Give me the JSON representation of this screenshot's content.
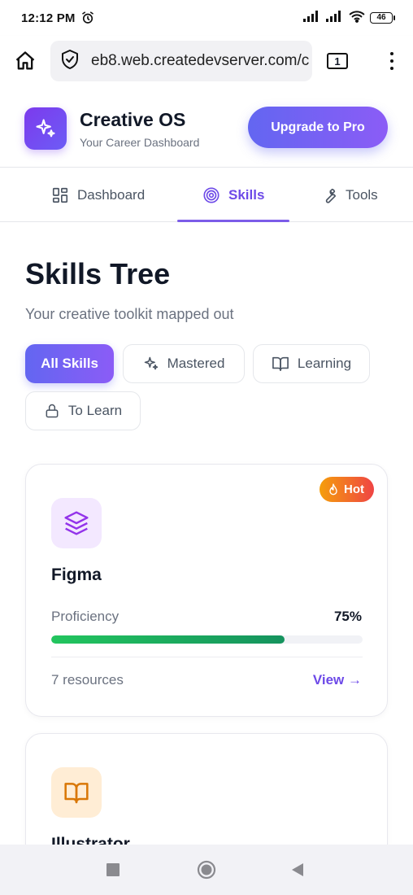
{
  "status_bar": {
    "time": "12:12 PM",
    "battery": "46"
  },
  "browser": {
    "url": "eb8.web.createdevserver.com/c",
    "tab_count": "1"
  },
  "header": {
    "app_name": "Creative OS",
    "tagline": "Your Career Dashboard",
    "upgrade_label": "Upgrade to Pro"
  },
  "tabs": [
    {
      "label": "Dashboard",
      "icon": "grid-icon",
      "active": false
    },
    {
      "label": "Skills",
      "icon": "target-icon",
      "active": true
    },
    {
      "label": "Tools",
      "icon": "wrench-icon",
      "active": false
    }
  ],
  "page": {
    "title": "Skills Tree",
    "subtitle": "Your creative toolkit mapped out"
  },
  "filters": [
    {
      "label": "All Skills",
      "icon": "",
      "active": true
    },
    {
      "label": "Mastered",
      "icon": "sparkles-icon",
      "active": false
    },
    {
      "label": "Learning",
      "icon": "book-icon",
      "active": false
    },
    {
      "label": "To Learn",
      "icon": "lock-icon",
      "active": false
    }
  ],
  "skills": [
    {
      "name": "Figma",
      "icon": "layers-icon",
      "badge": "Hot",
      "proficiency_label": "Proficiency",
      "proficiency_value": "75%",
      "proficiency": 0.75,
      "resources": "7 resources",
      "view_label": "View →"
    },
    {
      "name": "Illustrator",
      "icon": "book-open-icon"
    }
  ],
  "colors": {
    "accent": "#6d4ae8",
    "accent_gradient_start": "#6366f1",
    "accent_gradient_end": "#8b5cf6",
    "progress": "#22c55e",
    "hot_start": "#f59e0b",
    "hot_end": "#ef4444"
  }
}
